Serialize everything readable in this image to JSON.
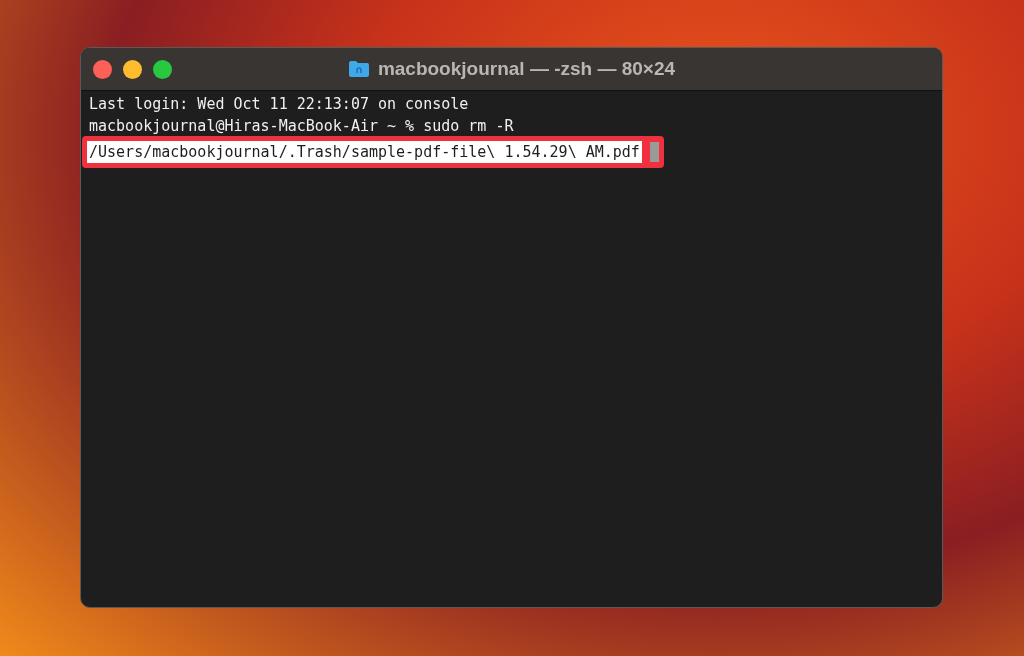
{
  "window": {
    "title": "macbookjournal — -zsh — 80×24"
  },
  "terminal": {
    "lines": [
      "Last login: Wed Oct 11 22:13:07 on console",
      "macbookjournal@Hiras-MacBook-Air ~ % sudo rm -R"
    ],
    "highlighted_input": "/Users/macbookjournal/.Trash/sample-pdf-file\\ 1.54.29\\ AM.pdf"
  }
}
